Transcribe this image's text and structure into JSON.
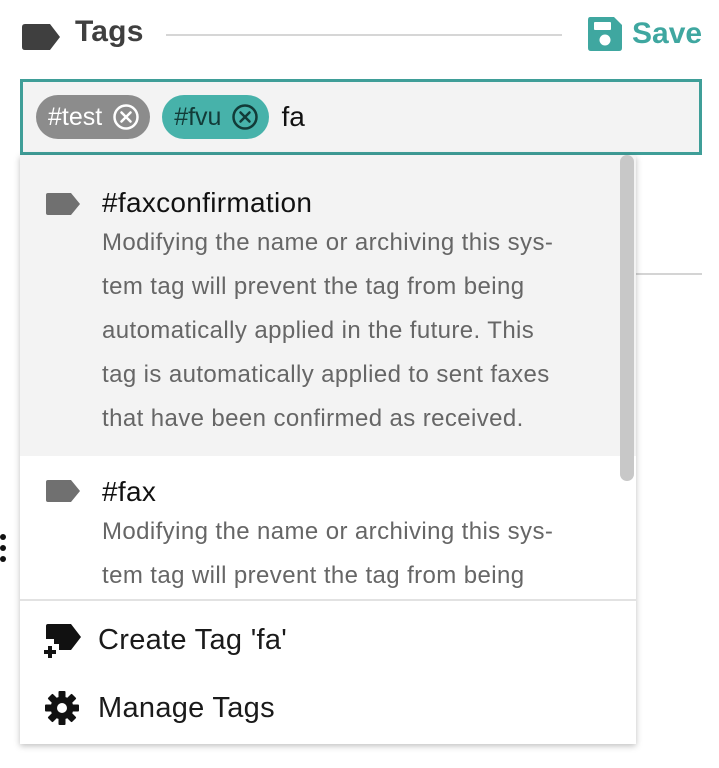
{
  "header": {
    "title": "Tags",
    "save_label": "Save",
    "tag_icon": "tag-icon",
    "save_icon": "floppy-disk-icon"
  },
  "input": {
    "chips": [
      {
        "label": "#test",
        "color": "#8c8c8c"
      },
      {
        "label": "#fvu",
        "color": "#47b2aa"
      }
    ],
    "value": "fa",
    "border_color": "#3f9e98"
  },
  "dropdown": {
    "options": [
      {
        "title": "#faxconfirmation",
        "description_lines": [
          "Modifying the name or archiving this sys-",
          "tem tag will prevent the tag from being",
          "automatically applied in the future. This",
          "tag is automatically applied to sent faxes",
          "that have been confirmed as received."
        ]
      },
      {
        "title": "#fax",
        "description_lines": [
          "Modifying the name or archiving this sys-",
          "tem tag will prevent the tag from being"
        ]
      }
    ],
    "actions": {
      "create_label": "Create Tag 'fa'",
      "manage_label": "Manage Tags"
    }
  },
  "colors": {
    "accent": "#3fa7a0",
    "chip_gray": "#8c8c8c",
    "chip_teal": "#47b2aa",
    "highlight_bg": "#f3f3f3"
  }
}
